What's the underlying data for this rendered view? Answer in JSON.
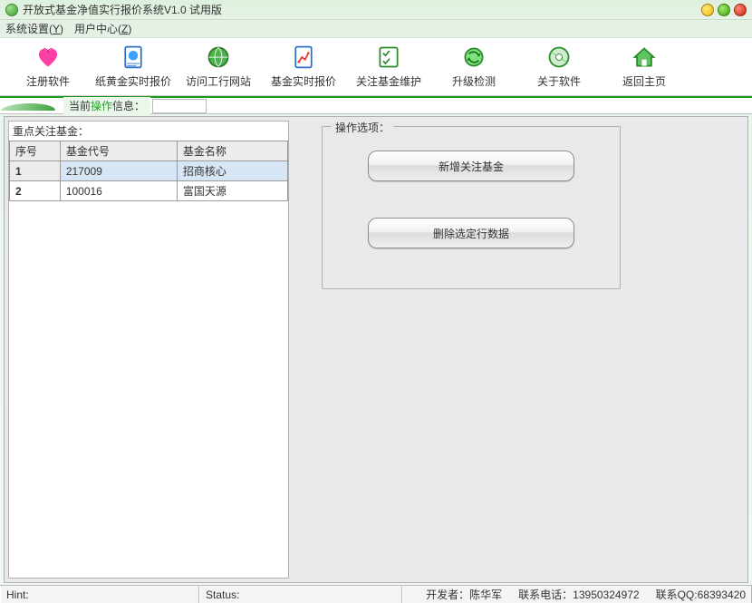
{
  "titlebar": {
    "text": "开放式基金净值实行报价系统V1.0  试用版"
  },
  "menubar": {
    "items": [
      {
        "label": "系统设置(",
        "hotkey": "Y",
        "suffix": ")"
      },
      {
        "label": "用户中心(",
        "hotkey": "Z",
        "suffix": ")"
      }
    ]
  },
  "toolbar": {
    "items": [
      {
        "label": "注册软件"
      },
      {
        "label": "纸黄金实时报价"
      },
      {
        "label": "访问工行网站"
      },
      {
        "label": "基金实时报价"
      },
      {
        "label": "关注基金维护"
      },
      {
        "label": "升级检测"
      },
      {
        "label": "关于软件"
      },
      {
        "label": "返回主页"
      }
    ]
  },
  "info_strip": {
    "prefix": "当前",
    "mid": "操作",
    "suffix": "信息："
  },
  "left_panel": {
    "title": "重点关注基金：",
    "columns": [
      "序号",
      "基金代号",
      "基金名称"
    ],
    "rows": [
      {
        "seq": "1",
        "code": "217009",
        "name": "招商核心",
        "selected": true
      },
      {
        "seq": "2",
        "code": "100016",
        "name": "富国天源",
        "selected": false
      }
    ]
  },
  "right_panel": {
    "legend": "操作选项：",
    "btn_add": "新增关注基金",
    "btn_del": "删除选定行数据"
  },
  "statusbar": {
    "hint_label": "Hint:",
    "status_label": "Status:",
    "developer": "开发者：陈华军",
    "phone": "联系电话：13950324972",
    "qq": "联系QQ:68393420"
  }
}
